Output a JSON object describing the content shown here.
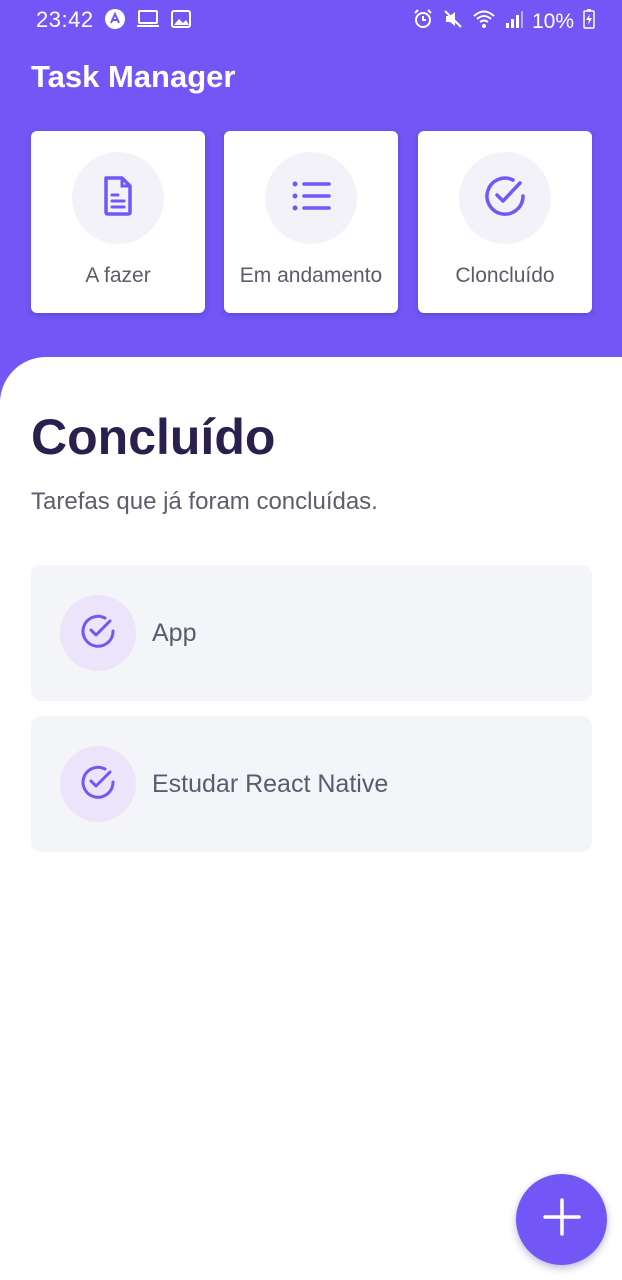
{
  "status_bar": {
    "time": "23:42",
    "battery": "10%",
    "left_icons": [
      "app-notification-icon",
      "laptop-icon",
      "image-icon"
    ],
    "right_icons": [
      "alarm-icon",
      "mute-icon",
      "wifi-icon",
      "signal-icon",
      "battery-charging-icon"
    ]
  },
  "app": {
    "title": "Task Manager"
  },
  "categories": [
    {
      "label": "A fazer",
      "icon": "document-icon"
    },
    {
      "label": "Em andamento",
      "icon": "list-icon"
    },
    {
      "label": "Cloncluído",
      "icon": "check-circle-icon"
    }
  ],
  "section": {
    "title": "Concluído",
    "subtitle": "Tarefas que já foram concluídas."
  },
  "tasks": [
    {
      "label": "App",
      "icon": "check-circle-icon"
    },
    {
      "label": "Estudar React Native",
      "icon": "check-circle-icon"
    }
  ],
  "fab": {
    "icon": "plus-icon"
  },
  "colors": {
    "primary": "#7357f6",
    "title_text": "#2a1f4d",
    "body_text": "#5b5b6b",
    "card_background": "#f4f5f9",
    "icon_circle": "#ebe4fb"
  }
}
